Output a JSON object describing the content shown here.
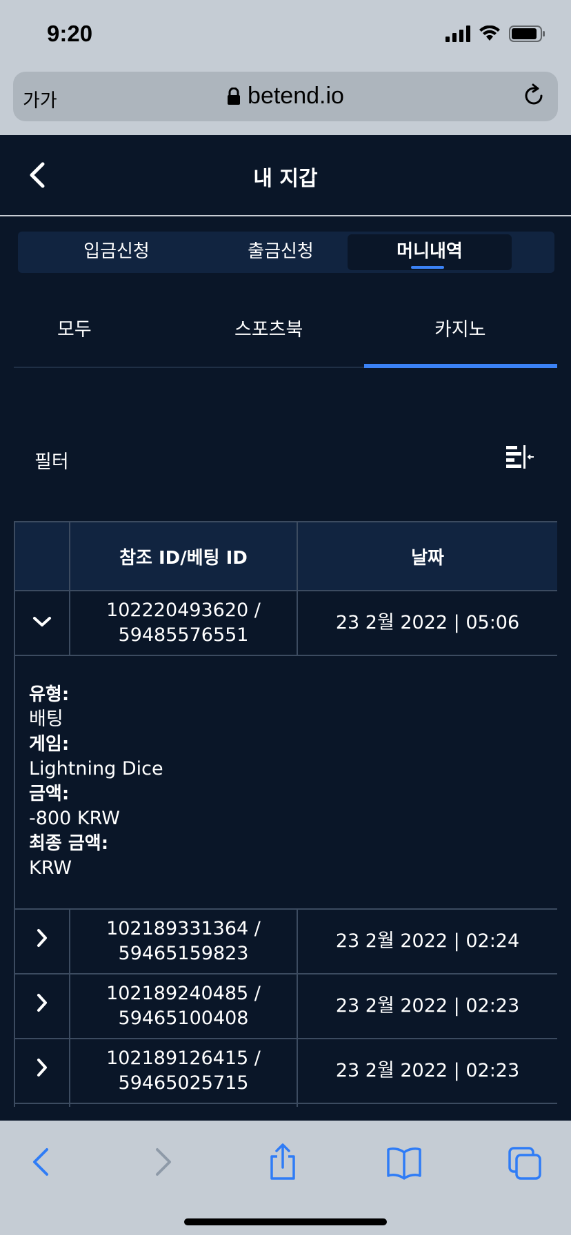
{
  "status_bar": {
    "time": "9:20"
  },
  "browser": {
    "aa_label": "가가",
    "url": "betend.io"
  },
  "header": {
    "title": "내 지갑"
  },
  "main_tabs": [
    {
      "label": "입금신청",
      "active": false
    },
    {
      "label": "출금신청",
      "active": false
    },
    {
      "label": "머니내역",
      "active": true
    }
  ],
  "sub_tabs": [
    {
      "label": "모두",
      "active": false
    },
    {
      "label": "스포츠북",
      "active": false
    },
    {
      "label": "카지노",
      "active": true
    }
  ],
  "filter": {
    "label": "필터"
  },
  "table": {
    "columns": [
      "",
      "참조 ID/베팅 ID",
      "날짜"
    ],
    "rows": [
      {
        "ref_id": "102220493620 /",
        "bet_id": "59485576551",
        "date": "23 2월 2022 | 05:06",
        "expanded": true,
        "details": {
          "type_key": "유형:",
          "type_val": "배팅",
          "game_key": "게임:",
          "game_val": "Lightning Dice",
          "amount_key": "금액:",
          "amount_val": "-800 KRW",
          "final_key": "최종 금액:",
          "final_val": "KRW"
        }
      },
      {
        "ref_id": "102189331364 /",
        "bet_id": "59465159823",
        "date": "23 2월 2022 | 02:24",
        "expanded": false
      },
      {
        "ref_id": "102189240485 /",
        "bet_id": "59465100408",
        "date": "23 2월 2022 | 02:23",
        "expanded": false
      },
      {
        "ref_id": "102189126415 /",
        "bet_id": "59465025715",
        "date": "23 2월 2022 | 02:23",
        "expanded": false
      }
    ]
  },
  "colors": {
    "background": "#0a1628",
    "accent": "#3b82f6",
    "tab_bg": "#112440",
    "ios_chrome": "#c5ccd4",
    "ios_blue": "#2f7cf6"
  },
  "icons": {
    "toolbar": [
      "back-icon",
      "forward-icon",
      "share-icon",
      "bookmarks-icon",
      "tabs-icon"
    ]
  }
}
